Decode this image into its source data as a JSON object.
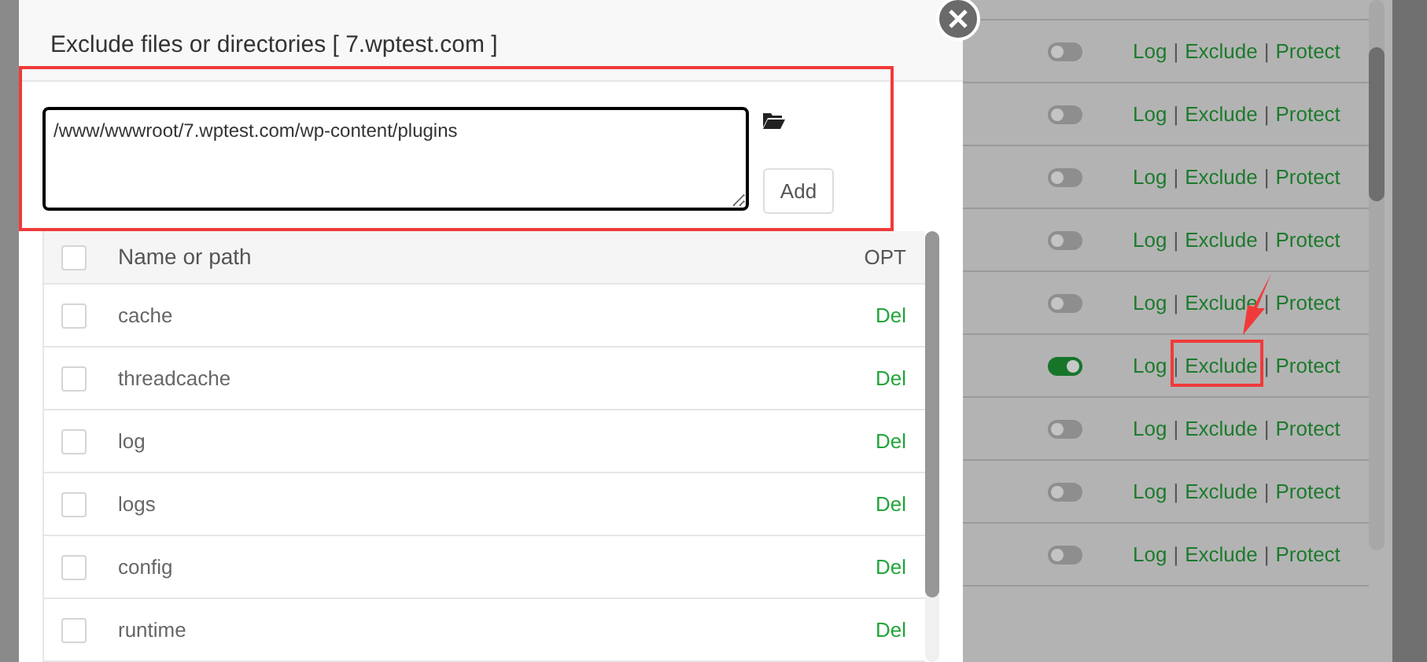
{
  "dialog": {
    "title": "Exclude files or directories [ 7.wptest.com ]",
    "path_input": {
      "value": "/www/wwwroot/7.wptest.com/wp-content/plugins"
    },
    "add_button": "Add",
    "table": {
      "columns": [
        "Name or path",
        "OPT"
      ],
      "header_checked": false,
      "rows": [
        {
          "name": "cache",
          "action": "Del",
          "checked": false
        },
        {
          "name": "threadcache",
          "action": "Del",
          "checked": false
        },
        {
          "name": "log",
          "action": "Del",
          "checked": false
        },
        {
          "name": "logs",
          "action": "Del",
          "checked": false
        },
        {
          "name": "config",
          "action": "Del",
          "checked": false
        },
        {
          "name": "runtime",
          "action": "Del",
          "checked": false
        }
      ]
    }
  },
  "background": {
    "rows": [
      {
        "on": false,
        "links": [
          "Log",
          "Exclude",
          "Protect"
        ],
        "separators": [
          "|",
          "|"
        ]
      },
      {
        "on": false,
        "links": [
          "Log",
          "Exclude",
          "Protect"
        ],
        "separators": [
          "|",
          "|"
        ]
      },
      {
        "on": false,
        "links": [
          "Log",
          "Exclude",
          "Protect"
        ],
        "separators": [
          "|",
          "|"
        ]
      },
      {
        "on": false,
        "links": [
          "Log",
          "Exclude",
          "Protect"
        ],
        "separators": [
          "|",
          "|"
        ]
      },
      {
        "on": false,
        "links": [
          "Log",
          "Exclude",
          "Protect"
        ],
        "separators": [
          "|",
          "|"
        ]
      },
      {
        "on": true,
        "links": [
          "Log",
          "Exclude",
          "Protect"
        ],
        "separators": [
          "|",
          "|"
        ]
      },
      {
        "on": false,
        "links": [
          "Log",
          "Exclude",
          "Protect"
        ],
        "separators": [
          "|",
          "|"
        ]
      },
      {
        "on": false,
        "links": [
          "Log",
          "Exclude",
          "Protect"
        ],
        "separators": [
          "|",
          "|"
        ]
      },
      {
        "on": false,
        "links": [
          "Log",
          "Exclude",
          "Protect"
        ],
        "separators": [
          "|",
          "|"
        ]
      }
    ]
  }
}
